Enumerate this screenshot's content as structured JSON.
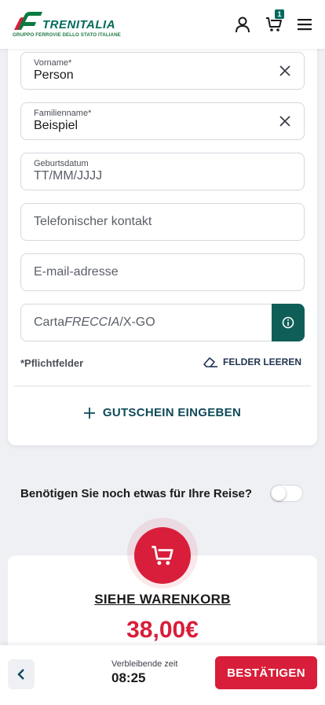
{
  "header": {
    "brand": "TRENITALIA",
    "brand_sub": "GRUPPO FERROVIE DELLO STATO ITALIANE",
    "cart_count": "1"
  },
  "form": {
    "first_name": {
      "label": "Vorname*",
      "value": "Person"
    },
    "last_name": {
      "label": "Familienname*",
      "value": "Beispiel"
    },
    "birthdate": {
      "label": "Geburtsdatum",
      "placeholder": "TT/MM/JJJJ"
    },
    "phone": {
      "placeholder": "Telefonischer kontakt"
    },
    "email": {
      "placeholder": "E-mail-adresse"
    },
    "card": {
      "placeholder_prefix": "Carta",
      "placeholder_italic": "FRECCIA",
      "placeholder_suffix": "/X-GO"
    },
    "required_note": "*Pflichtfelder",
    "clear_label": "FELDER LEEREN",
    "voucher_label": "GUTSCHEIN EINGEBEN"
  },
  "extras": {
    "question": "Benötigen Sie noch etwas für Ihre Reise?",
    "toggle_on": false
  },
  "cart": {
    "link_label": "SIEHE WARENKORB",
    "price": "38,00€"
  },
  "footer": {
    "timer_label": "Verbleibende zeit",
    "timer_value": "08:25",
    "confirm_label": "BESTÄTIGEN"
  },
  "colors": {
    "brand_green": "#006a5b",
    "accent_red": "#d81e3a",
    "info_teal": "#0f5f58"
  }
}
